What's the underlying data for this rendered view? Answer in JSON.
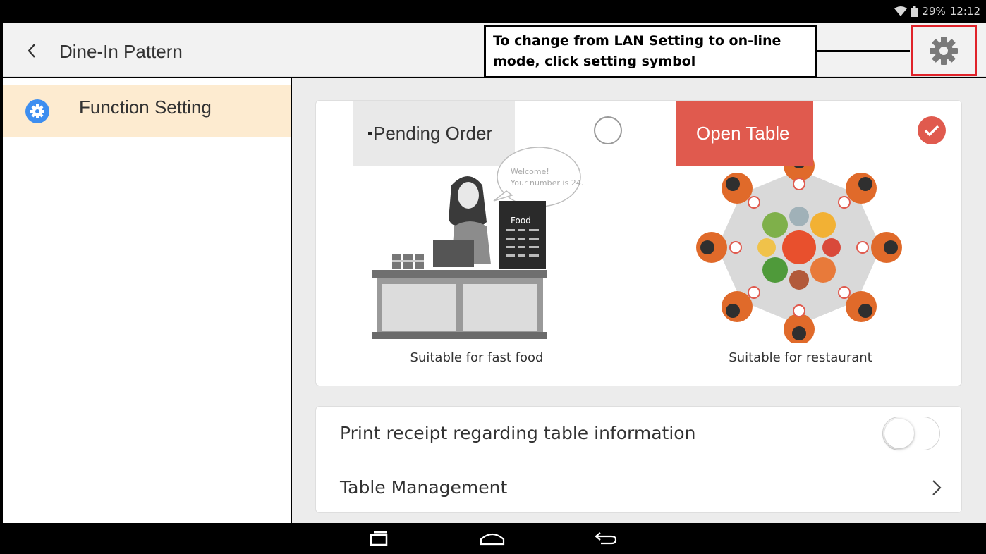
{
  "status_bar": {
    "battery": "29%",
    "time": "12:12",
    "icons": [
      "wifi-icon",
      "battery-icon"
    ]
  },
  "app_bar": {
    "title": "Dine-In Pattern",
    "back_icon": "chevron-left-icon",
    "settings_icon": "gear-icon"
  },
  "annotation": {
    "line1": "To change from LAN Setting to on-line",
    "line2": "mode, click setting symbol",
    "highlight_color": "#e0232a"
  },
  "sidebar": {
    "items": [
      {
        "label": "Function Setting",
        "icon": "gear-circle-icon",
        "selected": true
      }
    ]
  },
  "patterns": {
    "options": [
      {
        "label": "Pending Order",
        "caption": "Suitable for fast food",
        "selected": false
      },
      {
        "label": "Open Table",
        "caption": "Suitable for restaurant",
        "selected": true
      }
    ],
    "speech_bubble": {
      "line1": "Welcome!",
      "line2": "Your number is 24."
    },
    "menu_board": "Food"
  },
  "settings": {
    "print_receipt_label": "Print receipt regarding table information",
    "print_receipt_enabled": false,
    "table_management_label": "Table Management"
  },
  "colors": {
    "accent_red": "#e05a4e",
    "selected_bg": "#fdebd0",
    "icon_blue": "#3d8ef0"
  },
  "nav_bar": {
    "icons": [
      "recent-apps-icon",
      "home-icon",
      "back-icon"
    ]
  }
}
